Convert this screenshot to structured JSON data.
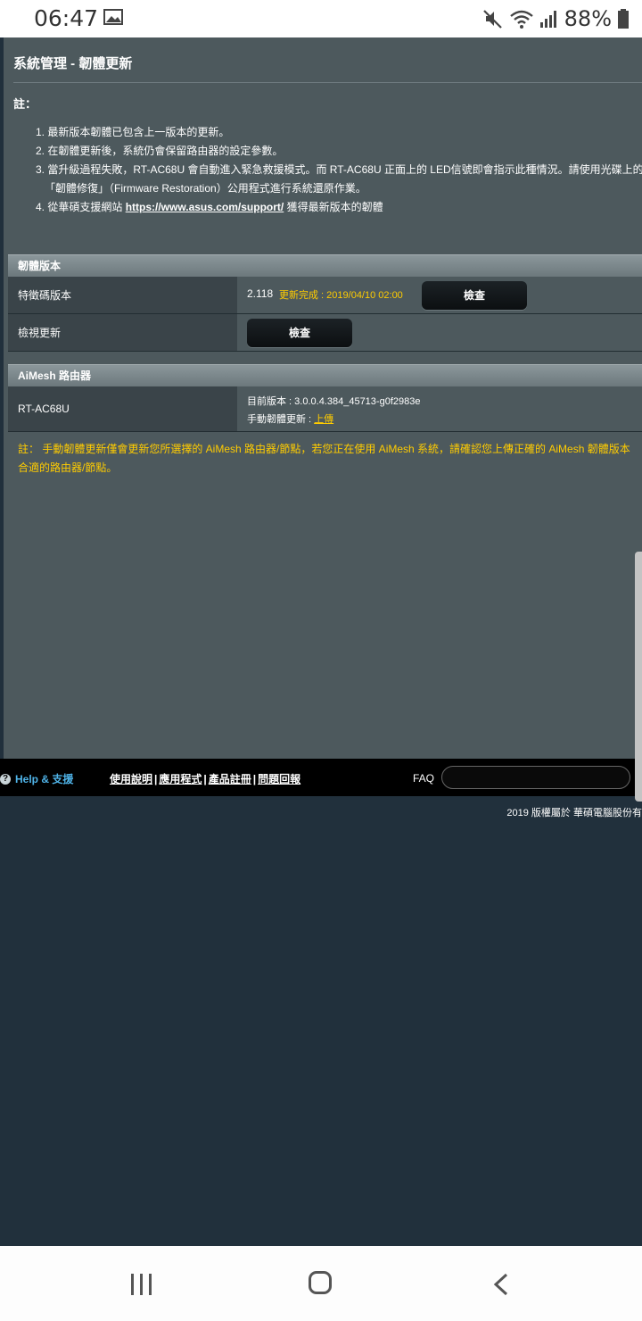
{
  "status_bar": {
    "time": "06:47",
    "battery": "88%"
  },
  "page": {
    "title": "系統管理 - 韌體更新",
    "note_label": "註：",
    "notes": [
      "1. 最新版本韌體已包含上一版本的更新。",
      "2. 在韌體更新後，系統仍會保留路由器的設定參數。",
      "3. 當升級過程失敗，RT-AC68U 會自動進入緊急救援模式。而 RT-AC68U 正面上的 LED信號即會指示此種情況。請使用光碟上的",
      "「韌體修復」（Firmware Restoration）公用程式進行系統還原作業。"
    ],
    "note4_prefix": "4. 從華碩支援網站 ",
    "note4_link": "https://www.asus.com/support/",
    "note4_suffix": " 獲得最新版本的韌體"
  },
  "firmware_section": {
    "header": "韌體版本",
    "signature_label": "特徵碼版本",
    "signature_version": "2.118",
    "signature_status": "更新完成 : 2019/04/10 02:00",
    "check_button": "檢查",
    "check_update_label": "檢視更新",
    "check_update_button": "檢查"
  },
  "aimesh_section": {
    "header": "AiMesh 路由器",
    "router_label": "RT-AC68U",
    "current_version": "目前版本 : 3.0.0.4.384_45713-g0f2983e",
    "manual_update_label": "手動韌體更新 : ",
    "upload_link": "上傳",
    "note_line1": "註： 手動韌體更新僅會更新您所選擇的 AiMesh 路由器/節點，若您正在使用 AiMesh 系統，請確認您上傳正確的 AiMesh 韌體版本",
    "note_line2": "合適的路由器/節點。"
  },
  "footer": {
    "help": "Help & 支援",
    "links": [
      "使用說明",
      "應用程式",
      "產品註冊",
      "問題回報"
    ],
    "faq": "FAQ",
    "copyright": "2019 版權屬於 華碩電腦股份有"
  }
}
